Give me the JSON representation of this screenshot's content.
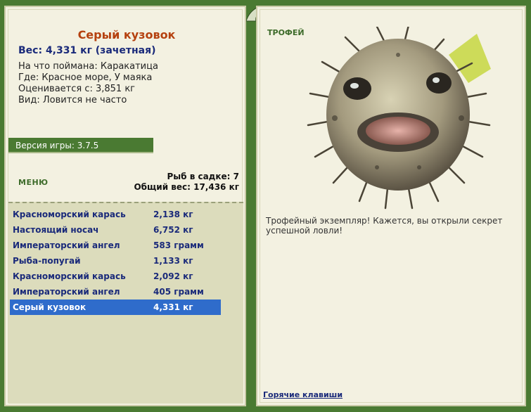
{
  "fish": {
    "name": "Серый кузовок",
    "weight_line": "Вес: 4,331 кг (зачетная)",
    "caught_on": "На что поймана: Каракатица",
    "where": "Где: Красное море, У маяка",
    "valued_from": "Оценивается с: 3,851 кг",
    "kind": "Вид: Ловится не часто"
  },
  "version": "Версия игры: 3.7.5",
  "menu_label": "МЕНЮ",
  "cage": {
    "count": "Рыб в садке: 7",
    "total": "Общий вес: 17,436 кг"
  },
  "catch_list": [
    {
      "name": "Красноморский карась",
      "weight": "2,138 кг"
    },
    {
      "name": "Настоящий носач",
      "weight": "6,752 кг"
    },
    {
      "name": "Императорский ангел",
      "weight": "583 грамм"
    },
    {
      "name": "Рыба-попугай",
      "weight": "1,133 кг"
    },
    {
      "name": "Красноморский карась",
      "weight": "2,092 кг"
    },
    {
      "name": "Императорский ангел",
      "weight": "405 грамм"
    },
    {
      "name": "Серый кузовок",
      "weight": "4,331 кг"
    }
  ],
  "selected_index": 6,
  "trophy": {
    "label": "ТРОФЕЙ",
    "text": "Трофейный экземпляр! Кажется, вы открыли секрет успешной ловли!"
  },
  "hotkeys_link": "Горячие клавиши",
  "colors": {
    "frame_green": "#4a7a32",
    "panel_bg": "#f3f1e1",
    "list_bg": "#dcdcbc",
    "selected_blue": "#2f6ccb",
    "title_orange": "#b5410f",
    "text_navy": "#1a2a7a"
  }
}
